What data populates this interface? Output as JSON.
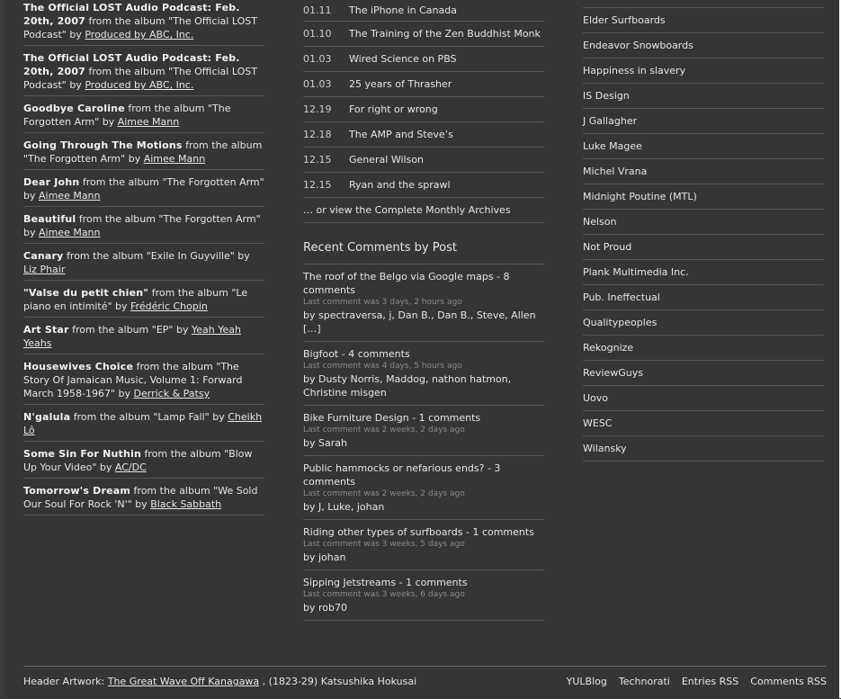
{
  "tracks": [
    {
      "title": "The Official LOST Audio Podcast: Feb. 20th, 2007",
      "pre": " from the album \"The Official LOST Podcast\" by ",
      "artist": "Produced by ABC, Inc."
    },
    {
      "title": "The Official LOST Audio Podcast: Feb. 20th, 2007",
      "pre": " from the album \"The Official LOST Podcast\" by ",
      "artist": "Produced by ABC, Inc."
    },
    {
      "title": "Goodbye Caroline",
      "pre": " from the album \"The Forgotten Arm\" by ",
      "artist": "Aimee Mann"
    },
    {
      "title": "Going Through The Motions",
      "pre": " from the album \"The Forgotten Arm\" by ",
      "artist": "Aimee Mann"
    },
    {
      "title": "Dear John",
      "pre": " from the album \"The Forgotten Arm\" by ",
      "artist": "Aimee Mann"
    },
    {
      "title": "Beautiful",
      "pre": " from the album \"The Forgotten Arm\" by ",
      "artist": "Aimee Mann"
    },
    {
      "title": "Canary",
      "pre": " from the album \"Exile In Guyville\" by ",
      "artist": "Liz Phair"
    },
    {
      "title": "\"Valse du petit chien\"",
      "pre": " from the album \"Le piano en intimité\" by ",
      "artist": "Frédéric Chopin"
    },
    {
      "title": "Art Star",
      "pre": " from the album \"EP\" by ",
      "artist": "Yeah Yeah Yeahs"
    },
    {
      "title": "Housewives Choice",
      "pre": " from the album \"The Story Of Jamaican Music, Volume 1: Forward March 1958-1967\" by ",
      "artist": "Derrick & Patsy"
    },
    {
      "title": "N'galula",
      "pre": " from the album \"Lamp Fall\" by ",
      "artist": "Cheikh Lô"
    },
    {
      "title": "Some Sin For Nuthin",
      "pre": " from the album \"Blow Up Your Video\" by ",
      "artist": "AC/DC"
    },
    {
      "title": "Tomorrow's Dream",
      "pre": " from the album \"We Sold Our Soul For Rock 'N'\" by ",
      "artist": "Black Sabbath"
    }
  ],
  "posts": [
    {
      "date": "01.11",
      "title": "The iPhone in Canada"
    },
    {
      "date": "01.10",
      "title": "The Training of the Zen Buddhist Monk"
    },
    {
      "date": "01.03",
      "title": "Wired Science on PBS"
    },
    {
      "date": "01.03",
      "title": "25 years of Thrasher"
    },
    {
      "date": "12.19",
      "title": "For right or wrong"
    },
    {
      "date": "12.18",
      "title": "The AMP and Steve’s"
    },
    {
      "date": "12.15",
      "title": "General Wilson"
    },
    {
      "date": "12.15",
      "title": "Ryan and the sprawl"
    }
  ],
  "archive_link": "… or view the Complete Monthly Archives",
  "recent_comments_title": "Recent Comments by Post",
  "comments": [
    {
      "title": "The roof of the Belgo via Google maps - 8 comments",
      "meta": "Last comment was 3 days, 2 hours ago",
      "by": "by spectraversa, j, Dan B., Dan B., Steve, Allen […]"
    },
    {
      "title": "Bigfoot - 4 comments",
      "meta": "Last comment was 4 days, 5 hours ago",
      "by": "by Dusty Norris, Maddog, nathon hatmon, Christine misgen"
    },
    {
      "title": "Bike Furniture Design - 1 comments",
      "meta": "Last comment was 2 weeks, 2 days ago",
      "by": "by Sarah"
    },
    {
      "title": "Public hammocks or nefarious ends? - 3 comments",
      "meta": "Last comment was 2 weeks, 2 days ago",
      "by": "by J, Luke, johan"
    },
    {
      "title": "Riding other types of surfboards - 1 comments",
      "meta": "Last comment was 3 weeks, 5 days ago",
      "by": "by johan"
    },
    {
      "title": "Sipping Jetstreams - 1 comments",
      "meta": "Last comment was 3 weeks, 6 days ago",
      "by": "by rob70"
    }
  ],
  "links": [
    "Elder Surfboards",
    "Endeavor Snowboards",
    "Happiness in slavery",
    "IS Design",
    "J Gallagher",
    "Luke Magee",
    "Michel Vrana",
    "Midnight Poutine (MTL)",
    "Nelson",
    "Not Proud",
    "Plank Multimedia Inc.",
    "Pub. Ineffectual",
    "Qualitypeoples",
    "Rekognize",
    "ReviewGuys",
    "Uovo",
    "WESC",
    "Wilansky"
  ],
  "footer": {
    "artwork_label": "Header Artwork: ",
    "artwork_link": "The Great Wave Off Kanagawa",
    "artwork_rest": " , (1823-29) Katsushika Hokusai",
    "nav": [
      "YULBlog",
      "Technorati",
      "Entries RSS",
      "Comments RSS"
    ]
  }
}
